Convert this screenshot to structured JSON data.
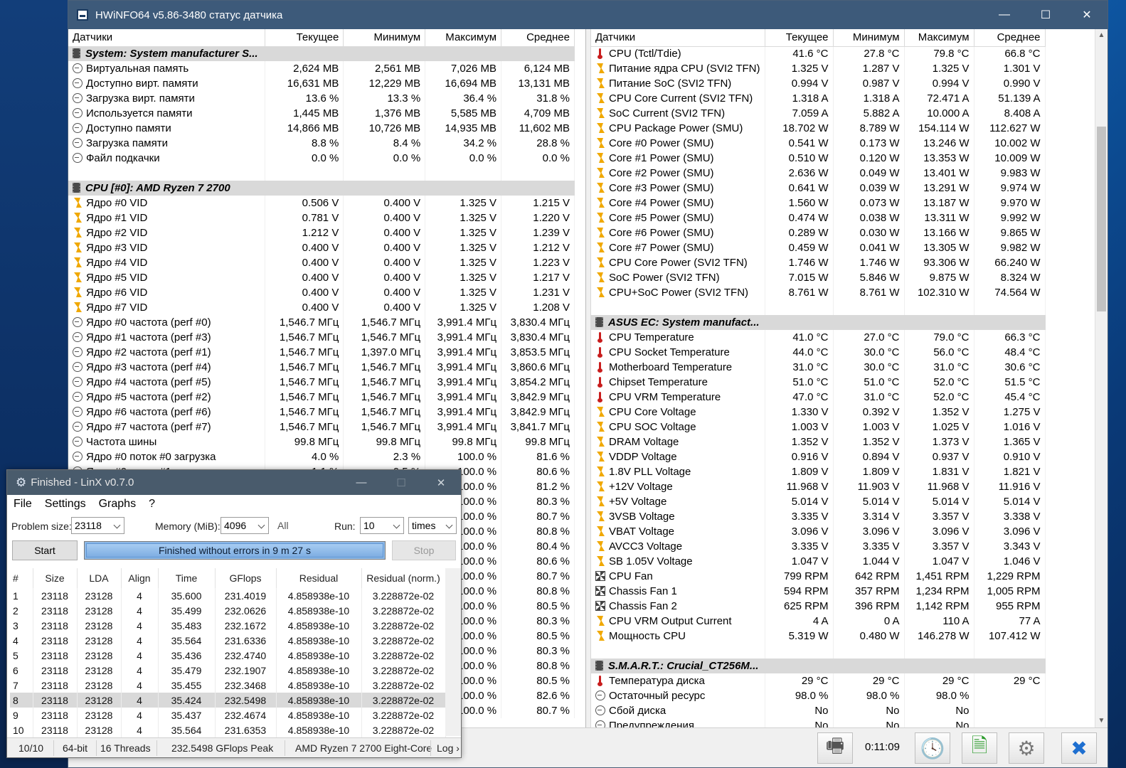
{
  "hwinfo": {
    "title": "HWiNFO64 v5.86-3480 статус датчика",
    "left_headers": [
      "Датчики",
      "Текущее",
      "Минимум",
      "Максимум",
      "Среднее"
    ],
    "right_headers": [
      "Датчики",
      "Текущее",
      "Минимум",
      "Максимум",
      "Среднее"
    ],
    "left_rows": [
      {
        "type": "group",
        "name": "System: System manufacturer S..."
      },
      {
        "icon": "clock",
        "name": "Виртуальная память",
        "cur": "2,624 MB",
        "min": "2,561 MB",
        "max": "7,026 MB",
        "avg": "6,124 MB"
      },
      {
        "icon": "clock",
        "name": "Доступно вирт. памяти",
        "cur": "16,631 MB",
        "min": "12,229 MB",
        "max": "16,694 MB",
        "avg": "13,131 MB"
      },
      {
        "icon": "clock",
        "name": "Загрузка вирт. памяти",
        "cur": "13.6 %",
        "min": "13.3 %",
        "max": "36.4 %",
        "avg": "31.8 %"
      },
      {
        "icon": "clock",
        "name": "Используется памяти",
        "cur": "1,445 MB",
        "min": "1,376 MB",
        "max": "5,585 MB",
        "avg": "4,709 MB"
      },
      {
        "icon": "clock",
        "name": "Доступно памяти",
        "cur": "14,866 MB",
        "min": "10,726 MB",
        "max": "14,935 MB",
        "avg": "11,602 MB"
      },
      {
        "icon": "clock",
        "name": "Загрузка памяти",
        "cur": "8.8 %",
        "min": "8.4 %",
        "max": "34.2 %",
        "avg": "28.8 %"
      },
      {
        "icon": "clock",
        "name": "Файл подкачки",
        "cur": "0.0 %",
        "min": "0.0 %",
        "max": "0.0 %",
        "avg": "0.0 %"
      },
      {
        "type": "blank"
      },
      {
        "type": "group",
        "name": "CPU [#0]: AMD Ryzen 7 2700"
      },
      {
        "icon": "bolt",
        "name": "Ядро #0 VID",
        "cur": "0.506 V",
        "min": "0.400 V",
        "max": "1.325 V",
        "avg": "1.215 V"
      },
      {
        "icon": "bolt",
        "name": "Ядро #1 VID",
        "cur": "0.781 V",
        "min": "0.400 V",
        "max": "1.325 V",
        "avg": "1.220 V"
      },
      {
        "icon": "bolt",
        "name": "Ядро #2 VID",
        "cur": "1.212 V",
        "min": "0.400 V",
        "max": "1.325 V",
        "avg": "1.239 V"
      },
      {
        "icon": "bolt",
        "name": "Ядро #3 VID",
        "cur": "0.400 V",
        "min": "0.400 V",
        "max": "1.325 V",
        "avg": "1.212 V"
      },
      {
        "icon": "bolt",
        "name": "Ядро #4 VID",
        "cur": "0.400 V",
        "min": "0.400 V",
        "max": "1.325 V",
        "avg": "1.223 V"
      },
      {
        "icon": "bolt",
        "name": "Ядро #5 VID",
        "cur": "0.400 V",
        "min": "0.400 V",
        "max": "1.325 V",
        "avg": "1.217 V"
      },
      {
        "icon": "bolt",
        "name": "Ядро #6 VID",
        "cur": "0.400 V",
        "min": "0.400 V",
        "max": "1.325 V",
        "avg": "1.231 V"
      },
      {
        "icon": "bolt",
        "name": "Ядро #7 VID",
        "cur": "0.400 V",
        "min": "0.400 V",
        "max": "1.325 V",
        "avg": "1.208 V"
      },
      {
        "icon": "clock",
        "name": "Ядро #0 частота (perf #0)",
        "cur": "1,546.7 МГц",
        "min": "1,546.7 МГц",
        "max": "3,991.4 МГц",
        "avg": "3,830.4 МГц"
      },
      {
        "icon": "clock",
        "name": "Ядро #1 частота (perf #3)",
        "cur": "1,546.7 МГц",
        "min": "1,546.7 МГц",
        "max": "3,991.4 МГц",
        "avg": "3,830.4 МГц"
      },
      {
        "icon": "clock",
        "name": "Ядро #2 частота (perf #1)",
        "cur": "1,546.7 МГц",
        "min": "1,397.0 МГц",
        "max": "3,991.4 МГц",
        "avg": "3,853.5 МГц"
      },
      {
        "icon": "clock",
        "name": "Ядро #3 частота (perf #4)",
        "cur": "1,546.7 МГц",
        "min": "1,546.7 МГц",
        "max": "3,991.4 МГц",
        "avg": "3,860.6 МГц"
      },
      {
        "icon": "clock",
        "name": "Ядро #4 частота (perf #5)",
        "cur": "1,546.7 МГц",
        "min": "1,546.7 МГц",
        "max": "3,991.4 МГц",
        "avg": "3,854.2 МГц"
      },
      {
        "icon": "clock",
        "name": "Ядро #5 частота (perf #2)",
        "cur": "1,546.7 МГц",
        "min": "1,546.7 МГц",
        "max": "3,991.4 МГц",
        "avg": "3,842.9 МГц"
      },
      {
        "icon": "clock",
        "name": "Ядро #6 частота (perf #6)",
        "cur": "1,546.7 МГц",
        "min": "1,546.7 МГц",
        "max": "3,991.4 МГц",
        "avg": "3,842.9 МГц"
      },
      {
        "icon": "clock",
        "name": "Ядро #7 частота (perf #7)",
        "cur": "1,546.7 МГц",
        "min": "1,546.7 МГц",
        "max": "3,991.4 МГц",
        "avg": "3,841.7 МГц"
      },
      {
        "icon": "clock",
        "name": "Частота шины",
        "cur": "99.8 МГц",
        "min": "99.8 МГц",
        "max": "99.8 МГц",
        "avg": "99.8 МГц"
      },
      {
        "icon": "clock",
        "name": "Ядро #0 поток #0 загрузка",
        "cur": "4.0 %",
        "min": "2.3 %",
        "max": "100.0 %",
        "avg": "81.6 %"
      },
      {
        "icon": "clock",
        "name": "Ядро #0 поток #1 загрузка",
        "cur": "1.1 %",
        "min": "0.5 %",
        "max": "100.0 %",
        "avg": "80.6 %"
      },
      {
        "icon": "clock",
        "name": "",
        "cur": "",
        "min": "",
        "max": "100.0 %",
        "avg": "81.2 %"
      },
      {
        "icon": "clock",
        "name": "",
        "cur": "",
        "min": "",
        "max": "100.0 %",
        "avg": "80.3 %"
      },
      {
        "icon": "clock",
        "name": "",
        "cur": "",
        "min": "",
        "max": "100.0 %",
        "avg": "80.7 %"
      },
      {
        "icon": "clock",
        "name": "",
        "cur": "",
        "min": "",
        "max": "100.0 %",
        "avg": "80.8 %"
      },
      {
        "icon": "clock",
        "name": "",
        "cur": "",
        "min": "",
        "max": "100.0 %",
        "avg": "80.4 %"
      },
      {
        "icon": "clock",
        "name": "",
        "cur": "",
        "min": "",
        "max": "100.0 %",
        "avg": "80.6 %"
      },
      {
        "icon": "clock",
        "name": "",
        "cur": "",
        "min": "",
        "max": "100.0 %",
        "avg": "80.7 %"
      },
      {
        "icon": "clock",
        "name": "",
        "cur": "",
        "min": "",
        "max": "100.0 %",
        "avg": "80.8 %"
      },
      {
        "icon": "clock",
        "name": "",
        "cur": "",
        "min": "",
        "max": "100.0 %",
        "avg": "80.5 %"
      },
      {
        "icon": "clock",
        "name": "",
        "cur": "",
        "min": "",
        "max": "100.0 %",
        "avg": "80.3 %"
      },
      {
        "icon": "clock",
        "name": "",
        "cur": "",
        "min": "",
        "max": "100.0 %",
        "avg": "80.5 %"
      },
      {
        "icon": "clock",
        "name": "",
        "cur": "",
        "min": "",
        "max": "100.0 %",
        "avg": "80.3 %"
      },
      {
        "icon": "clock",
        "name": "",
        "cur": "",
        "min": "",
        "max": "100.0 %",
        "avg": "80.8 %"
      },
      {
        "icon": "clock",
        "name": "",
        "cur": "",
        "min": "",
        "max": "100.0 %",
        "avg": "80.5 %"
      },
      {
        "icon": "clock",
        "name": "",
        "cur": "",
        "min": "",
        "max": "100.0 %",
        "avg": "82.6 %"
      },
      {
        "icon": "clock",
        "name": "",
        "cur": "",
        "min": "",
        "max": "100.0 %",
        "avg": "80.7 %"
      }
    ],
    "right_rows": [
      {
        "icon": "therm",
        "name": "CPU (Tctl/Tdie)",
        "cur": "41.6 °C",
        "min": "27.8 °C",
        "max": "79.8 °C",
        "avg": "66.8 °C"
      },
      {
        "icon": "bolt",
        "name": "Питание ядра CPU (SVI2 TFN)",
        "cur": "1.325 V",
        "min": "1.287 V",
        "max": "1.325 V",
        "avg": "1.301 V"
      },
      {
        "icon": "bolt",
        "name": "Питание SoC (SVI2 TFN)",
        "cur": "0.994 V",
        "min": "0.987 V",
        "max": "0.994 V",
        "avg": "0.990 V"
      },
      {
        "icon": "bolt",
        "name": "CPU Core Current (SVI2 TFN)",
        "cur": "1.318 A",
        "min": "1.318 A",
        "max": "72.471 A",
        "avg": "51.139 A"
      },
      {
        "icon": "bolt",
        "name": "SoC Current (SVI2 TFN)",
        "cur": "7.059 A",
        "min": "5.882 A",
        "max": "10.000 A",
        "avg": "8.408 A"
      },
      {
        "icon": "bolt",
        "name": "CPU Package Power (SMU)",
        "cur": "18.702 W",
        "min": "8.789 W",
        "max": "154.114 W",
        "avg": "112.627 W"
      },
      {
        "icon": "bolt",
        "name": "Core #0 Power (SMU)",
        "cur": "0.541 W",
        "min": "0.173 W",
        "max": "13.246 W",
        "avg": "10.002 W"
      },
      {
        "icon": "bolt",
        "name": "Core #1 Power (SMU)",
        "cur": "0.510 W",
        "min": "0.120 W",
        "max": "13.353 W",
        "avg": "10.009 W"
      },
      {
        "icon": "bolt",
        "name": "Core #2 Power (SMU)",
        "cur": "2.636 W",
        "min": "0.049 W",
        "max": "13.401 W",
        "avg": "9.983 W"
      },
      {
        "icon": "bolt",
        "name": "Core #3 Power (SMU)",
        "cur": "0.641 W",
        "min": "0.039 W",
        "max": "13.291 W",
        "avg": "9.974 W"
      },
      {
        "icon": "bolt",
        "name": "Core #4 Power (SMU)",
        "cur": "1.560 W",
        "min": "0.073 W",
        "max": "13.187 W",
        "avg": "9.970 W"
      },
      {
        "icon": "bolt",
        "name": "Core #5 Power (SMU)",
        "cur": "0.474 W",
        "min": "0.038 W",
        "max": "13.311 W",
        "avg": "9.992 W"
      },
      {
        "icon": "bolt",
        "name": "Core #6 Power (SMU)",
        "cur": "0.289 W",
        "min": "0.030 W",
        "max": "13.166 W",
        "avg": "9.865 W"
      },
      {
        "icon": "bolt",
        "name": "Core #7 Power (SMU)",
        "cur": "0.459 W",
        "min": "0.041 W",
        "max": "13.305 W",
        "avg": "9.982 W"
      },
      {
        "icon": "bolt",
        "name": "CPU Core Power (SVI2 TFN)",
        "cur": "1.746 W",
        "min": "1.746 W",
        "max": "93.306 W",
        "avg": "66.240 W"
      },
      {
        "icon": "bolt",
        "name": "SoC Power (SVI2 TFN)",
        "cur": "7.015 W",
        "min": "5.846 W",
        "max": "9.875 W",
        "avg": "8.324 W"
      },
      {
        "icon": "bolt",
        "name": "CPU+SoC Power (SVI2 TFN)",
        "cur": "8.761 W",
        "min": "8.761 W",
        "max": "102.310 W",
        "avg": "74.564 W"
      },
      {
        "type": "blank"
      },
      {
        "type": "group",
        "name": "ASUS EC: System manufact..."
      },
      {
        "icon": "therm",
        "name": "CPU Temperature",
        "cur": "41.0 °C",
        "min": "27.0 °C",
        "max": "79.0 °C",
        "avg": "66.3 °C"
      },
      {
        "icon": "therm",
        "name": "CPU Socket Temperature",
        "cur": "44.0 °C",
        "min": "30.0 °C",
        "max": "56.0 °C",
        "avg": "48.4 °C"
      },
      {
        "icon": "therm",
        "name": "Motherboard Temperature",
        "cur": "31.0 °C",
        "min": "30.0 °C",
        "max": "31.0 °C",
        "avg": "30.6 °C"
      },
      {
        "icon": "therm",
        "name": "Chipset Temperature",
        "cur": "51.0 °C",
        "min": "51.0 °C",
        "max": "52.0 °C",
        "avg": "51.5 °C"
      },
      {
        "icon": "therm",
        "name": "CPU VRM Temperature",
        "cur": "47.0 °C",
        "min": "31.0 °C",
        "max": "52.0 °C",
        "avg": "45.4 °C"
      },
      {
        "icon": "bolt",
        "name": "CPU Core Voltage",
        "cur": "1.330 V",
        "min": "0.392 V",
        "max": "1.352 V",
        "avg": "1.275 V"
      },
      {
        "icon": "bolt",
        "name": "CPU SOC Voltage",
        "cur": "1.003 V",
        "min": "1.003 V",
        "max": "1.025 V",
        "avg": "1.016 V"
      },
      {
        "icon": "bolt",
        "name": "DRAM Voltage",
        "cur": "1.352 V",
        "min": "1.352 V",
        "max": "1.373 V",
        "avg": "1.365 V"
      },
      {
        "icon": "bolt",
        "name": "VDDP Voltage",
        "cur": "0.916 V",
        "min": "0.894 V",
        "max": "0.937 V",
        "avg": "0.910 V"
      },
      {
        "icon": "bolt",
        "name": "1.8V PLL Voltage",
        "cur": "1.809 V",
        "min": "1.809 V",
        "max": "1.831 V",
        "avg": "1.821 V"
      },
      {
        "icon": "bolt",
        "name": "+12V Voltage",
        "cur": "11.968 V",
        "min": "11.903 V",
        "max": "11.968 V",
        "avg": "11.916 V"
      },
      {
        "icon": "bolt",
        "name": "+5V Voltage",
        "cur": "5.014 V",
        "min": "5.014 V",
        "max": "5.014 V",
        "avg": "5.014 V"
      },
      {
        "icon": "bolt",
        "name": "3VSB Voltage",
        "cur": "3.335 V",
        "min": "3.314 V",
        "max": "3.357 V",
        "avg": "3.338 V"
      },
      {
        "icon": "bolt",
        "name": "VBAT Voltage",
        "cur": "3.096 V",
        "min": "3.096 V",
        "max": "3.096 V",
        "avg": "3.096 V"
      },
      {
        "icon": "bolt",
        "name": "AVCC3 Voltage",
        "cur": "3.335 V",
        "min": "3.335 V",
        "max": "3.357 V",
        "avg": "3.343 V"
      },
      {
        "icon": "bolt",
        "name": "SB 1.05V Voltage",
        "cur": "1.047 V",
        "min": "1.044 V",
        "max": "1.047 V",
        "avg": "1.046 V"
      },
      {
        "icon": "fan",
        "name": "CPU Fan",
        "cur": "799 RPM",
        "min": "642 RPM",
        "max": "1,451 RPM",
        "avg": "1,229 RPM"
      },
      {
        "icon": "fan",
        "name": "Chassis Fan 1",
        "cur": "594 RPM",
        "min": "357 RPM",
        "max": "1,234 RPM",
        "avg": "1,005 RPM"
      },
      {
        "icon": "fan",
        "name": "Chassis Fan 2",
        "cur": "625 RPM",
        "min": "396 RPM",
        "max": "1,142 RPM",
        "avg": "955 RPM"
      },
      {
        "icon": "bolt",
        "name": "CPU VRM Output Current",
        "cur": "4 A",
        "min": "0 A",
        "max": "110 A",
        "avg": "77 A"
      },
      {
        "icon": "bolt",
        "name": "Мощность CPU",
        "cur": "5.319 W",
        "min": "0.480 W",
        "max": "146.278 W",
        "avg": "107.412 W"
      },
      {
        "type": "blank"
      },
      {
        "type": "group",
        "name": "S.M.A.R.T.: Crucial_CT256M..."
      },
      {
        "icon": "therm",
        "name": "Температура диска",
        "cur": "29 °C",
        "min": "29 °C",
        "max": "29 °C",
        "avg": "29 °C"
      },
      {
        "icon": "clock",
        "name": "Остаточный ресурс",
        "cur": "98.0 %",
        "min": "98.0 %",
        "max": "98.0 %",
        "avg": ""
      },
      {
        "icon": "clock",
        "name": "Сбой диска",
        "cur": "No",
        "min": "No",
        "max": "No",
        "avg": ""
      },
      {
        "icon": "clock",
        "name": "Предупреждения",
        "cur": "No",
        "min": "No",
        "max": "No",
        "avg": ""
      }
    ],
    "timer": "0:11:09"
  },
  "linx": {
    "title": "Finished - LinX v0.7.0",
    "menu": [
      "File",
      "Settings",
      "Graphs",
      "?"
    ],
    "problem_size_label": "Problem size:",
    "problem_size": "23118",
    "memory_label": "Memory (MiB):",
    "memory": "4096",
    "all_label": "All",
    "run_label": "Run:",
    "run": "10",
    "run_unit": "times",
    "start_label": "Start",
    "stop_label": "Stop",
    "progress_text": "Finished without errors in 9 m 27 s",
    "headers": [
      "#",
      "Size",
      "LDA",
      "Align",
      "Time",
      "GFlops",
      "Residual",
      "Residual (norm.)"
    ],
    "rows": [
      [
        "1",
        "23118",
        "23128",
        "4",
        "35.600",
        "231.4019",
        "4.858938e-10",
        "3.228872e-02"
      ],
      [
        "2",
        "23118",
        "23128",
        "4",
        "35.499",
        "232.0626",
        "4.858938e-10",
        "3.228872e-02"
      ],
      [
        "3",
        "23118",
        "23128",
        "4",
        "35.483",
        "232.1672",
        "4.858938e-10",
        "3.228872e-02"
      ],
      [
        "4",
        "23118",
        "23128",
        "4",
        "35.564",
        "231.6336",
        "4.858938e-10",
        "3.228872e-02"
      ],
      [
        "5",
        "23118",
        "23128",
        "4",
        "35.436",
        "232.4740",
        "4.858938e-10",
        "3.228872e-02"
      ],
      [
        "6",
        "23118",
        "23128",
        "4",
        "35.479",
        "232.1907",
        "4.858938e-10",
        "3.228872e-02"
      ],
      [
        "7",
        "23118",
        "23128",
        "4",
        "35.455",
        "232.3468",
        "4.858938e-10",
        "3.228872e-02"
      ],
      [
        "8",
        "23118",
        "23128",
        "4",
        "35.424",
        "232.5498",
        "4.858938e-10",
        "3.228872e-02"
      ],
      [
        "9",
        "23118",
        "23128",
        "4",
        "35.437",
        "232.4674",
        "4.858938e-10",
        "3.228872e-02"
      ],
      [
        "10",
        "23118",
        "23128",
        "4",
        "35.564",
        "231.6353",
        "4.858938e-10",
        "3.228872e-02"
      ]
    ],
    "selected_row": 8,
    "status": [
      "10/10",
      "64-bit",
      "16 Threads",
      "232.5498 GFlops Peak",
      "AMD Ryzen 7 2700 Eight-Core",
      "Log ›"
    ]
  }
}
